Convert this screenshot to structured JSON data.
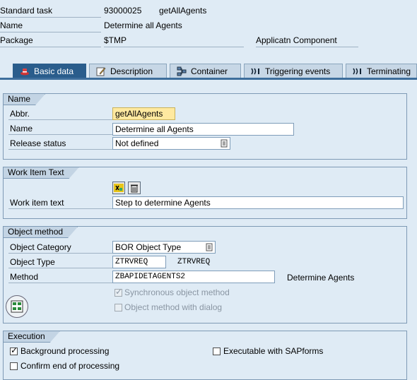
{
  "header": {
    "rows": [
      {
        "label": "Standard task",
        "value": "93000025",
        "extra": "getAllAgents"
      },
      {
        "label": "Name",
        "value": "Determine all Agents"
      },
      {
        "label": "Package",
        "value": "$TMP",
        "extra": "Applicatn Component"
      }
    ]
  },
  "tabs": [
    {
      "label": "Basic data",
      "icon": "hat-icon",
      "active": true
    },
    {
      "label": "Description",
      "icon": "edit-icon"
    },
    {
      "label": "Container",
      "icon": "container-icon"
    },
    {
      "label": "Triggering events",
      "icon": "event-icon"
    },
    {
      "label": "Terminating",
      "icon": "event-icon"
    }
  ],
  "name_group": {
    "title": "Name",
    "abbr_label": "Abbr.",
    "abbr_value": "getAllAgents",
    "name_label": "Name",
    "name_value": "Determine all Agents",
    "release_label": "Release status",
    "release_value": "Not defined"
  },
  "work_item_group": {
    "title": "Work Item Text",
    "text_label": "Work item text",
    "text_value": "Step to determine Agents"
  },
  "object_method_group": {
    "title": "Object method",
    "category_label": "Object Category",
    "category_value": "BOR Object Type",
    "type_label": "Object Type",
    "type_value": "ZTRVREQ",
    "type_desc": "ZTRVREQ",
    "method_label": "Method",
    "method_value": "ZBAPIDETAGENTS2",
    "method_desc": "Determine Agents",
    "sync_label": "Synchronous object method",
    "sync_checked": true,
    "dialog_label": "Object method with dialog",
    "dialog_checked": false
  },
  "execution_group": {
    "title": "Execution",
    "background_label": "Background processing",
    "background_checked": true,
    "confirm_label": "Confirm end of processing",
    "confirm_checked": false,
    "sapforms_label": "Executable with SAPforms",
    "sapforms_checked": false
  },
  "colors": {
    "background": "#dfebf5",
    "active_tab": "#2a5d8c",
    "highlight_field": "#ffe9a0"
  }
}
